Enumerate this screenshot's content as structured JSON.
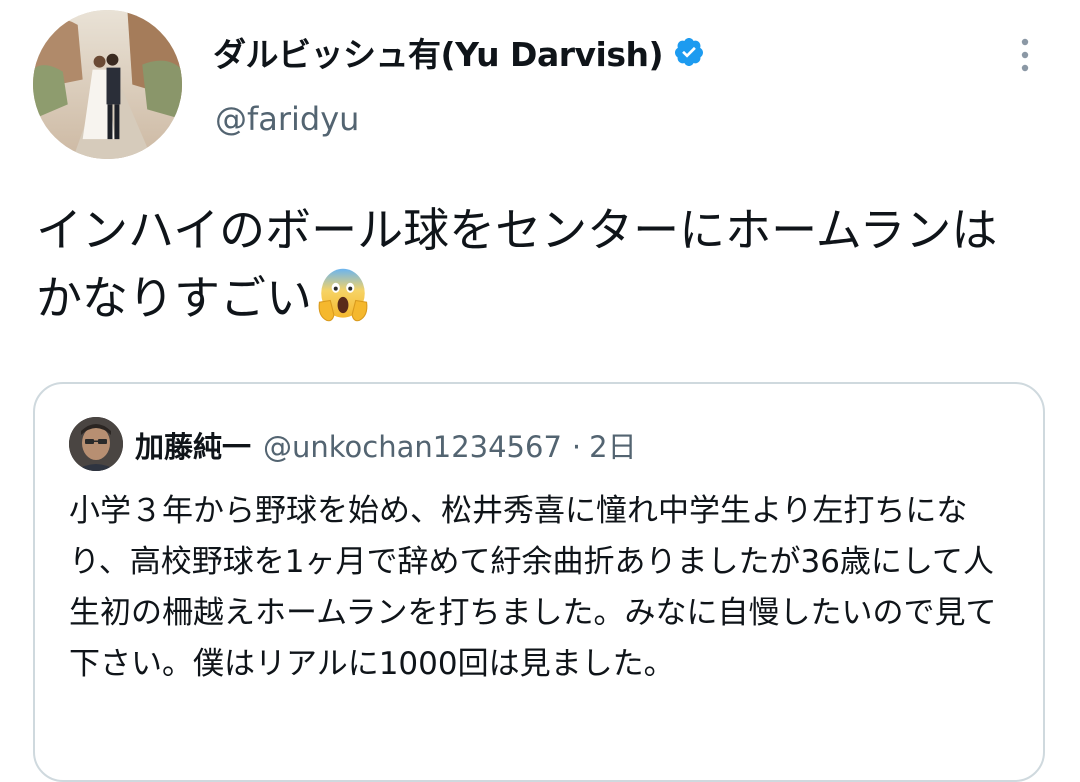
{
  "tweet": {
    "author": {
      "display_name": "ダルビッシュ有(Yu Darvish)",
      "handle": "@faridyu",
      "verified": true,
      "avatar_icon": "wedding-photo-avatar"
    },
    "text": "インハイのボール球をセンターにホームランはかなりすごい",
    "emoji": "face-screaming-in-fear-emoji",
    "menu_icon": "more-vertical-icon"
  },
  "quoted_tweet": {
    "author": {
      "display_name": "加藤純一",
      "handle": "@unkochan1234567",
      "avatar_icon": "user-photo-avatar"
    },
    "separator": "·",
    "time": "2日",
    "text": "小学３年から野球を始め、松井秀喜に憧れ中学生より左打ちになり、高校野球を1ヶ月で辞めて紆余曲折ありましたが36歳にして人生初の柵越えホームランを打ちました。みなに自慢したいので見て下さい。僕はリアルに1000回は見ました。"
  },
  "colors": {
    "text_primary": "#0f1419",
    "text_secondary": "#536471",
    "verified_blue": "#1d9bf0",
    "card_border": "#cfd9de"
  }
}
